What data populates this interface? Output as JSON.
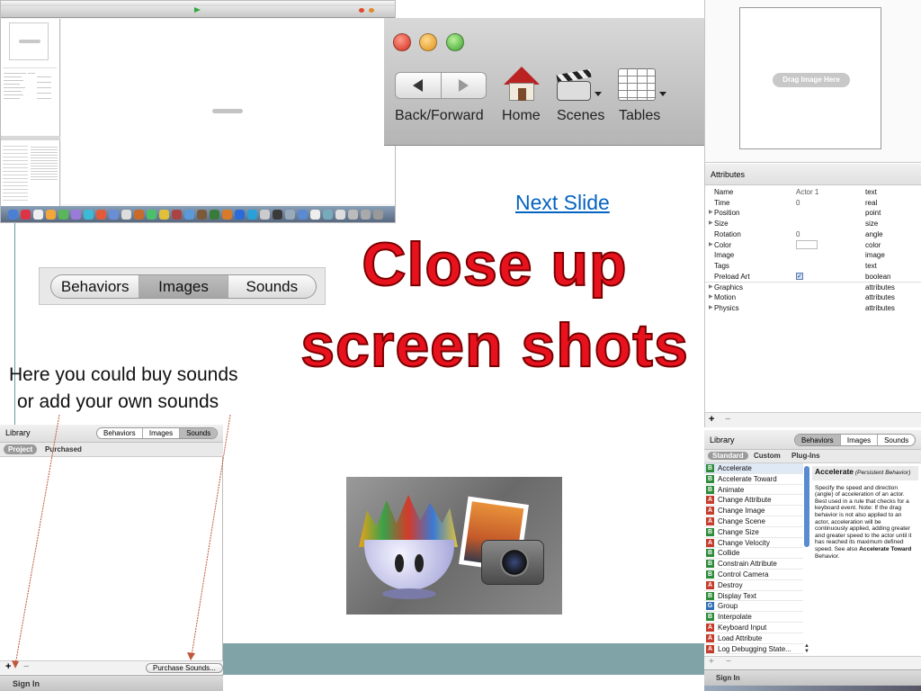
{
  "slide": {
    "next_link": "Next Slide",
    "title_line1": "Close up",
    "title_line2": "screen shots",
    "caption_line1": "Here you could buy sounds",
    "caption_line2": "or add your own sounds"
  },
  "main_screenshot": {
    "drag_hint": "Drag Image Here"
  },
  "toolbar_closeup": {
    "items": [
      "Back/Forward",
      "Home",
      "Scenes",
      "Tables"
    ]
  },
  "segmented": {
    "tabs": [
      "Behaviors",
      "Images",
      "Sounds"
    ],
    "selected": "Images"
  },
  "attributes_panel": {
    "drop_zone": "Drag Image Here",
    "header": "Attributes",
    "rows": [
      {
        "name": "Name",
        "value": "Actor 1",
        "type": "text",
        "expand": ""
      },
      {
        "name": "Time",
        "value": "0",
        "type": "real",
        "expand": ""
      },
      {
        "name": "Position",
        "value": "",
        "type": "point",
        "expand": "▶"
      },
      {
        "name": "Size",
        "value": "",
        "type": "size",
        "expand": "▶"
      },
      {
        "name": "Rotation",
        "value": "0",
        "type": "angle",
        "expand": ""
      },
      {
        "name": "Color",
        "value": "",
        "type": "color",
        "expand": "▶"
      },
      {
        "name": "Image",
        "value": "",
        "type": "image",
        "expand": ""
      },
      {
        "name": "Tags",
        "value": "",
        "type": "text",
        "expand": ""
      },
      {
        "name": "Preload Art",
        "value": "",
        "type": "boolean",
        "expand": ""
      },
      {
        "name": "Graphics",
        "value": "",
        "type": "attributes",
        "expand": "▶"
      },
      {
        "name": "Motion",
        "value": "",
        "type": "attributes",
        "expand": "▶"
      },
      {
        "name": "Physics",
        "value": "",
        "type": "attributes",
        "expand": "▶"
      }
    ],
    "add": "+",
    "remove": "−"
  },
  "library_left": {
    "title": "Library",
    "tabs": [
      "Behaviors",
      "Images",
      "Sounds"
    ],
    "selected": "Sounds",
    "subtabs": [
      "Project",
      "Purchased"
    ],
    "add": "+",
    "remove": "−",
    "purchase": "Purchase Sounds...",
    "sign_in": "Sign In"
  },
  "library_right": {
    "title": "Library",
    "tabs": [
      "Behaviors",
      "Images",
      "Sounds"
    ],
    "selected": "Behaviors",
    "subtabs": [
      "Standard",
      "Custom",
      "Plug-Ins"
    ],
    "items": [
      {
        "badge": "B",
        "label": "Accelerate",
        "color": "#2e8b3a"
      },
      {
        "badge": "B",
        "label": "Accelerate Toward",
        "color": "#2e8b3a"
      },
      {
        "badge": "B",
        "label": "Animate",
        "color": "#2e8b3a"
      },
      {
        "badge": "A",
        "label": "Change Attribute",
        "color": "#c43c2c"
      },
      {
        "badge": "A",
        "label": "Change Image",
        "color": "#c43c2c"
      },
      {
        "badge": "A",
        "label": "Change Scene",
        "color": "#c43c2c"
      },
      {
        "badge": "B",
        "label": "Change Size",
        "color": "#2e8b3a"
      },
      {
        "badge": "A",
        "label": "Change Velocity",
        "color": "#c43c2c"
      },
      {
        "badge": "B",
        "label": "Collide",
        "color": "#2e8b3a"
      },
      {
        "badge": "B",
        "label": "Constrain Attribute",
        "color": "#2e8b3a"
      },
      {
        "badge": "B",
        "label": "Control Camera",
        "color": "#2e8b3a"
      },
      {
        "badge": "A",
        "label": "Destroy",
        "color": "#c43c2c"
      },
      {
        "badge": "B",
        "label": "Display Text",
        "color": "#2e8b3a"
      },
      {
        "badge": "G",
        "label": "Group",
        "color": "#2f6fb6"
      },
      {
        "badge": "B",
        "label": "Interpolate",
        "color": "#2e8b3a"
      },
      {
        "badge": "A",
        "label": "Keyboard Input",
        "color": "#c43c2c"
      },
      {
        "badge": "A",
        "label": "Load Attribute",
        "color": "#c43c2c"
      },
      {
        "badge": "A",
        "label": "Log Debugging State...",
        "color": "#c43c2c"
      }
    ],
    "detail_title": "Accelerate",
    "detail_subtitle": "(Persistent Behavior)",
    "detail_text": "Specify the speed and direction (angle) of acceleration of an actor. Best used in a rule that checks for a keyboard event. Note: If the drag behavior is not also applied to an actor, acceleration will be continuously applied, adding greater and greater speed to the actor until it has reached its maximum defined speed. See also",
    "detail_link": "Accelerate Toward",
    "detail_end": "Behavior.",
    "add": "+",
    "remove": "−",
    "sign_in": "Sign In"
  },
  "colors": {
    "title_red": "#e8121e",
    "link_blue": "#0563c1",
    "teal_band": "#7fa3a6"
  }
}
